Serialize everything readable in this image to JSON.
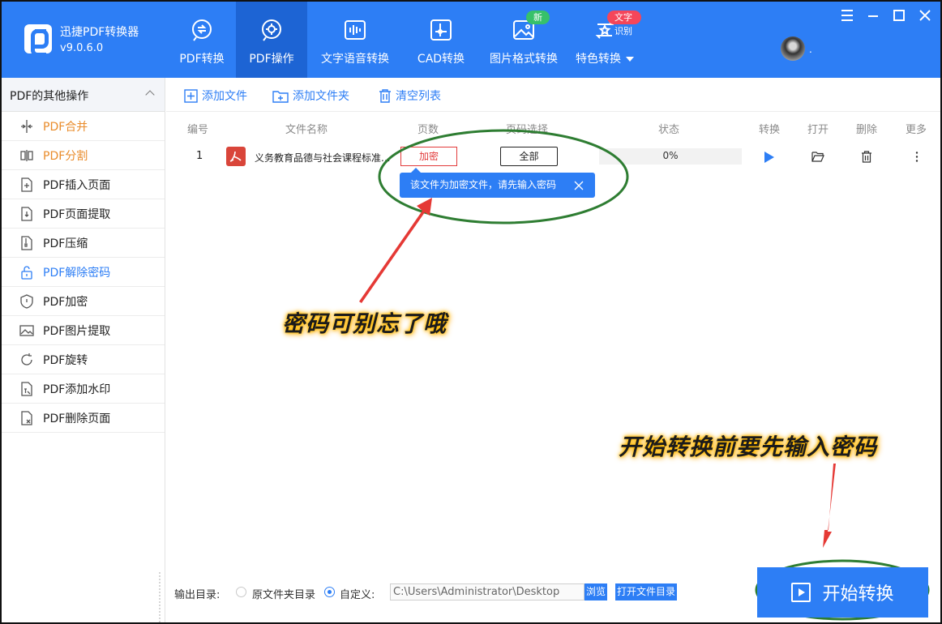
{
  "app": {
    "name": "迅捷PDF转换器",
    "version": "v9.0.6.0"
  },
  "nav": [
    {
      "label": "PDF转换",
      "icon": "pdf-convert-icon"
    },
    {
      "label": "PDF操作",
      "icon": "pdf-operate-icon"
    },
    {
      "label": "文字语音转换",
      "icon": "audio-wave-icon"
    },
    {
      "label": "CAD转换",
      "icon": "cad-icon"
    },
    {
      "label": "图片格式转换",
      "icon": "image-icon"
    },
    {
      "label": "特色转换",
      "icon": "special-convert-icon"
    }
  ],
  "badges": {
    "new": "新",
    "ocr": "文字识别"
  },
  "user": {
    "name": "."
  },
  "sidebar": {
    "title": "PDF的其他操作",
    "items": [
      {
        "label": "PDF合并"
      },
      {
        "label": "PDF分割"
      },
      {
        "label": "PDF插入页面"
      },
      {
        "label": "PDF页面提取"
      },
      {
        "label": "PDF压缩"
      },
      {
        "label": "PDF解除密码"
      },
      {
        "label": "PDF加密"
      },
      {
        "label": "PDF图片提取"
      },
      {
        "label": "PDF旋转"
      },
      {
        "label": "PDF添加水印"
      },
      {
        "label": "PDF删除页面"
      }
    ]
  },
  "toolbar": {
    "add_file": "添加文件",
    "add_folder": "添加文件夹",
    "clear_list": "清空列表"
  },
  "table": {
    "headers": {
      "index": "编号",
      "filename": "文件名称",
      "pages": "页数",
      "page_select": "页码选择",
      "status": "状态",
      "convert": "转换",
      "open": "打开",
      "delete": "删除",
      "more": "更多"
    },
    "rows": [
      {
        "index": "1",
        "filename": "义务教育品德与社会课程标准...",
        "pages": "加密",
        "page_select": "全部",
        "status": "0%"
      }
    ]
  },
  "tooltip": {
    "text": "该文件为加密文件，请先输入密码"
  },
  "annotations": {
    "top": "密码可别忘了哦",
    "bottom": "开始转换前要先输入密码"
  },
  "output": {
    "label": "输出目录:",
    "opt_original": "原文件夹目录",
    "opt_custom": "自定义:",
    "path": "C:\\Users\\Administrator\\Desktop",
    "browse": "浏览",
    "open_dir": "打开文件目录"
  },
  "start": {
    "label": "开始转换"
  },
  "colors": {
    "brand": "#2d7ef5",
    "active_nav": "#1d64d4",
    "warning": "#e23b3b",
    "annotation_green": "#2e7d32",
    "arrow_red": "#e53935"
  }
}
